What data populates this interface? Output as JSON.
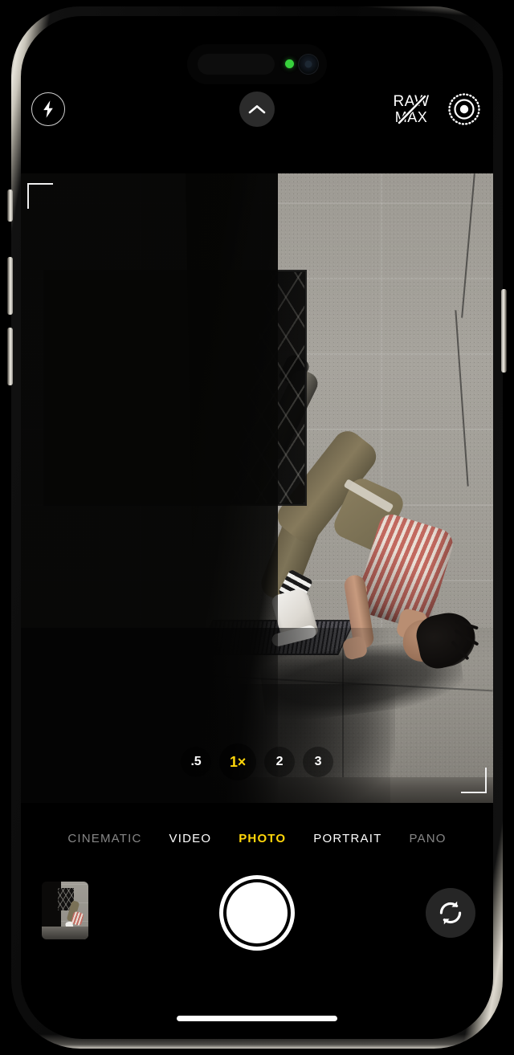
{
  "app": {
    "name": "Camera",
    "device": "iPhone",
    "status_indicator": "camera-in-use-green-dot"
  },
  "top_controls": {
    "flash": {
      "label": "Flash",
      "icon": "flash-icon",
      "state": "auto"
    },
    "expand": {
      "label": "More controls",
      "icon": "chevron-up-icon"
    },
    "raw_max": {
      "line1": "RAW",
      "line2": "MAX",
      "icon": "raw-max-off-icon",
      "state": "off"
    },
    "photographic_styles": {
      "label": "Photographic Styles",
      "icon": "photographic-styles-icon"
    }
  },
  "viewfinder": {
    "scene_description": "Breakdancer mid-handstand flip against a sunlit concrete wall with a metal lattice gate in deep shadow",
    "corner_brackets": [
      "top-left",
      "bottom-right"
    ]
  },
  "zoom": {
    "options": [
      {
        "label": ".5",
        "value": "0.5x",
        "selected": false
      },
      {
        "label": "1×",
        "value": "1x",
        "selected": true
      },
      {
        "label": "2",
        "value": "2x",
        "selected": false
      },
      {
        "label": "3",
        "value": "3x",
        "selected": false
      }
    ],
    "selected": "1×"
  },
  "modes": {
    "items": [
      {
        "label": "CINEMATIC",
        "selected": false,
        "dim": true
      },
      {
        "label": "VIDEO",
        "selected": false,
        "dim": false
      },
      {
        "label": "PHOTO",
        "selected": true,
        "dim": false
      },
      {
        "label": "PORTRAIT",
        "selected": false,
        "dim": false
      },
      {
        "label": "PANO",
        "selected": false,
        "dim": true
      }
    ],
    "selected": "PHOTO"
  },
  "bottom_controls": {
    "thumbnail": {
      "label": "Photo Library",
      "icon": "last-photo-thumbnail"
    },
    "shutter": {
      "label": "Take Photo",
      "icon": "shutter-button"
    },
    "flip": {
      "label": "Switch Camera",
      "icon": "camera-flip-icon"
    }
  },
  "home_indicator": {
    "label": "Home Indicator"
  },
  "colors": {
    "accent_yellow": "#ffd60a",
    "white": "#ffffff",
    "dark_button": "#2b2b2b",
    "status_green": "#37d13c"
  }
}
